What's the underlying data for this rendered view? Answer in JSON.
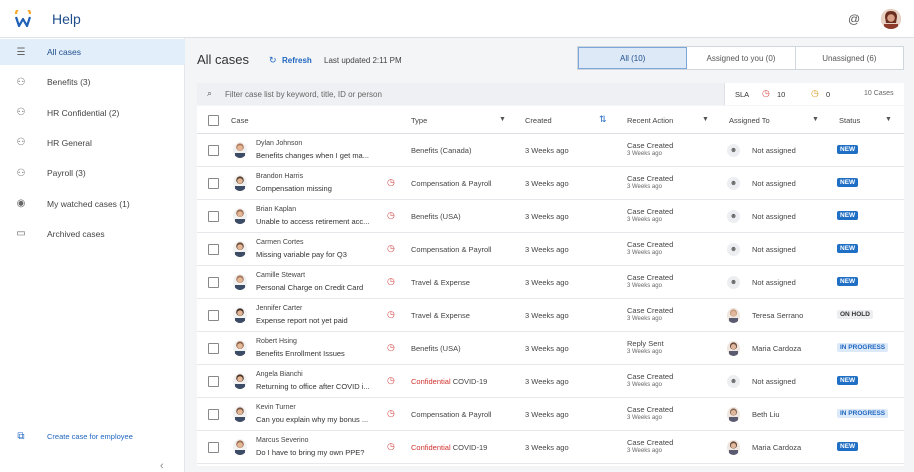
{
  "header": {
    "title": "Help",
    "at_icon": "@"
  },
  "sidebar": {
    "items": [
      {
        "label": "All cases",
        "icon": "menu-icon",
        "glyph": "☰",
        "active": true
      },
      {
        "label": "Benefits (3)",
        "icon": "group-icon",
        "glyph": "⚇"
      },
      {
        "label": "HR Confidential (2)",
        "icon": "group-icon",
        "glyph": "⚇"
      },
      {
        "label": "HR General",
        "icon": "group-icon",
        "glyph": "⚇"
      },
      {
        "label": "Payroll (3)",
        "icon": "group-icon",
        "glyph": "⚇"
      },
      {
        "label": "My watched cases (1)",
        "icon": "eye-icon",
        "glyph": "◉"
      },
      {
        "label": "Archived cases",
        "icon": "archive-icon",
        "glyph": "▭"
      }
    ],
    "create_case": {
      "label": "Create case for employee",
      "glyph": "⧉"
    },
    "collapse_glyph": "‹"
  },
  "main": {
    "title": "All cases",
    "refresh_label": "Refresh",
    "refresh_glyph": "↻",
    "last_updated": "Last updated 2:11 PM",
    "tabs": [
      {
        "label": "All (10)",
        "active": true
      },
      {
        "label": "Assigned to you (0)"
      },
      {
        "label": "Unassigned (6)"
      }
    ],
    "filter": {
      "placeholder": "Filter case list by keyword, title, ID or person",
      "search_glyph": "⌕"
    },
    "sla": {
      "label": "SLA",
      "red_count": "10",
      "amber_count": "0",
      "case_count": "10 Cases",
      "red_glyph": "◷",
      "amber_glyph": "◷"
    }
  },
  "table": {
    "columns": {
      "case": "Case",
      "type": "Type",
      "created": "Created",
      "recent_action": "Recent Action",
      "assigned_to": "Assigned To",
      "status": "Status"
    },
    "sort_glyph": "⇅",
    "filter_glyph": "▼",
    "rows": [
      {
        "name": "Dylan Johnson",
        "desc": "Benefits changes when I get ma...",
        "sla": false,
        "type": "Benefits (Canada)",
        "confidential": false,
        "created": "3 Weeks ago",
        "action": "Case Created",
        "action_sub": "3 Weeks ago",
        "assignee": "Not assigned",
        "assignee_photo": false,
        "status": "NEW",
        "status_kind": "new",
        "avatar_color": "#b07a5a"
      },
      {
        "name": "Brandon Harris",
        "desc": "Compensation missing",
        "sla": true,
        "type": "Compensation & Payroll",
        "confidential": false,
        "created": "3 Weeks ago",
        "action": "Case Created",
        "action_sub": "3 Weeks ago",
        "assignee": "Not assigned",
        "assignee_photo": false,
        "status": "NEW",
        "status_kind": "new",
        "avatar_color": "#5b4030"
      },
      {
        "name": "Brian Kaplan",
        "desc": "Unable to access retirement acc...",
        "sla": true,
        "type": "Benefits (USA)",
        "confidential": false,
        "created": "3 Weeks ago",
        "action": "Case Created",
        "action_sub": "3 Weeks ago",
        "assignee": "Not assigned",
        "assignee_photo": false,
        "status": "NEW",
        "status_kind": "new",
        "avatar_color": "#9a6b4f"
      },
      {
        "name": "Carmen Cortes",
        "desc": "Missing variable pay for Q3",
        "sla": true,
        "type": "Compensation & Payroll",
        "confidential": false,
        "created": "3 Weeks ago",
        "action": "Case Created",
        "action_sub": "3 Weeks ago",
        "assignee": "Not assigned",
        "assignee_photo": false,
        "status": "NEW",
        "status_kind": "new",
        "avatar_color": "#6e4a36"
      },
      {
        "name": "Camille Stewart",
        "desc": "Personal Charge on Credit Card",
        "sla": true,
        "type": "Travel & Expense",
        "confidential": false,
        "created": "3 Weeks ago",
        "action": "Case Created",
        "action_sub": "3 Weeks ago",
        "assignee": "Not assigned",
        "assignee_photo": false,
        "status": "NEW",
        "status_kind": "new",
        "avatar_color": "#a3755a"
      },
      {
        "name": "Jennifer Carter",
        "desc": "Expense report not yet paid",
        "sla": true,
        "type": "Travel & Expense",
        "confidential": false,
        "created": "3 Weeks ago",
        "action": "Case Created",
        "action_sub": "3 Weeks ago",
        "assignee": "Teresa Serrano",
        "assignee_photo": true,
        "assignee_color": "#c49a7a",
        "status": "ON HOLD",
        "status_kind": "hold",
        "avatar_color": "#3e2a20"
      },
      {
        "name": "Robert Hsing",
        "desc": "Benefits Enrollment Issues",
        "sla": true,
        "type": "Benefits (USA)",
        "confidential": false,
        "created": "3 Weeks ago",
        "action": "Reply Sent",
        "action_sub": "3 Weeks ago",
        "assignee": "Maria Cardoza",
        "assignee_photo": true,
        "assignee_color": "#6a4838",
        "status": "IN PROGRESS",
        "status_kind": "progress",
        "avatar_color": "#8c5e44"
      },
      {
        "name": "Angela Bianchi",
        "desc": "Returning to office after COVID i...",
        "sla": true,
        "type_prefix": "Confidential",
        "type": "COVID-19",
        "confidential": true,
        "created": "3 Weeks ago",
        "action": "Case Created",
        "action_sub": "3 Weeks ago",
        "assignee": "Not assigned",
        "assignee_photo": false,
        "status": "NEW",
        "status_kind": "new",
        "avatar_color": "#4a3226"
      },
      {
        "name": "Kevin Turner",
        "desc": "Can you explain why my bonus ...",
        "sla": true,
        "type": "Compensation & Payroll",
        "confidential": false,
        "created": "3 Weeks ago",
        "action": "Case Created",
        "action_sub": "3 Weeks ago",
        "assignee": "Beth Liu",
        "assignee_photo": true,
        "assignee_color": "#8a6a52",
        "status": "IN PROGRESS",
        "status_kind": "progress",
        "avatar_color": "#7a553f"
      },
      {
        "name": "Marcus Severino",
        "desc": "Do I have to bring my own PPE?",
        "sla": true,
        "type_prefix": "Confidential",
        "type": "COVID-19",
        "confidential": true,
        "created": "3 Weeks ago",
        "action": "Case Created",
        "action_sub": "3 Weeks ago",
        "assignee": "Maria Cardoza",
        "assignee_photo": true,
        "assignee_color": "#6a4838",
        "status": "NEW",
        "status_kind": "new",
        "avatar_color": "#9b6c50"
      }
    ]
  },
  "colors": {
    "accent": "#1f66c1",
    "brand": "#1f4f8c",
    "sla_red": "#d64545",
    "sla_amber": "#d89a1b",
    "confidential": "#d0312d"
  }
}
